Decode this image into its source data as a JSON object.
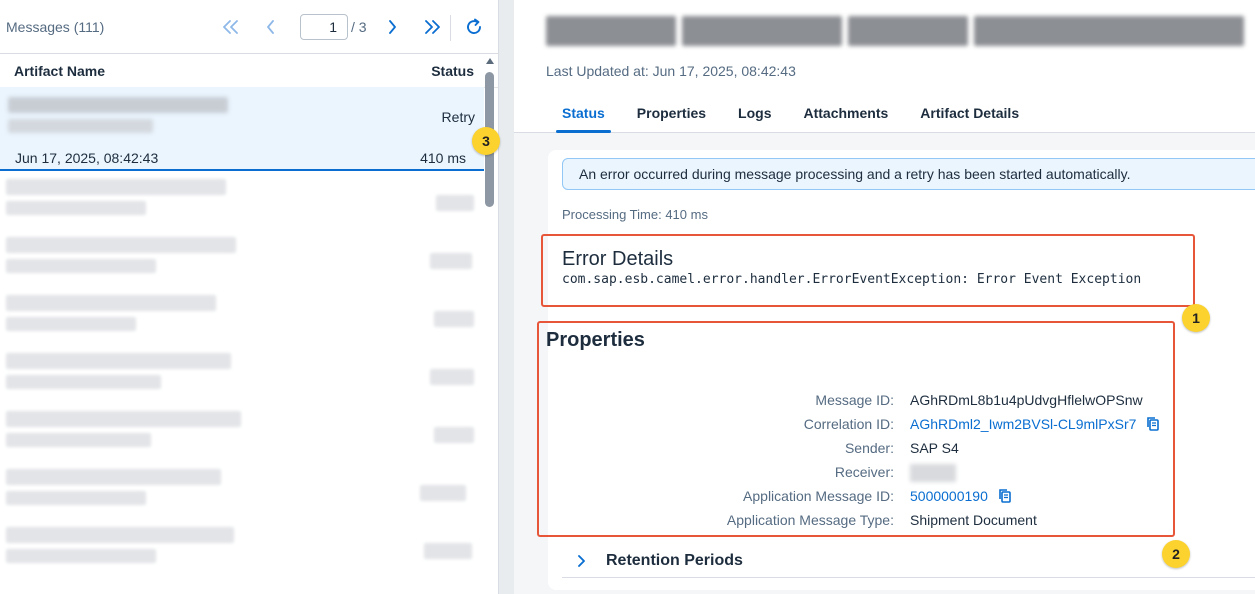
{
  "left_pane": {
    "messages_count": "Messages (111)",
    "page_current": "1",
    "page_total": "/ 3",
    "columns": {
      "artifact": "Artifact Name",
      "status": "Status"
    },
    "selected_row": {
      "status": "Retry",
      "date": "Jun 17, 2025, 08:42:43",
      "duration": "410 ms"
    }
  },
  "header": {
    "last_updated": "Last Updated at: Jun 17, 2025, 08:42:43",
    "tabs": [
      {
        "label": "Status",
        "active": true
      },
      {
        "label": "Properties",
        "active": false
      },
      {
        "label": "Logs",
        "active": false
      },
      {
        "label": "Attachments",
        "active": false
      },
      {
        "label": "Artifact Details",
        "active": false
      }
    ]
  },
  "status": {
    "message_strip": "An error occurred during message processing and a retry has been started automatically.",
    "processing_time": "Processing Time: 410 ms",
    "error_title": "Error Details",
    "error_text": "com.sap.esb.camel.error.handler.ErrorEventException: Error Event Exception"
  },
  "properties": {
    "title": "Properties",
    "items": [
      {
        "key": "Message ID:",
        "value": "AGhRDmL8b1u4pUdvgHflelwOPSnw"
      },
      {
        "key": "Correlation ID:",
        "value": "AGhRDml2_Iwm2BVSl-CL9mlPxSr7"
      },
      {
        "key": "Sender:",
        "value": "SAP S4"
      },
      {
        "key": "Receiver:",
        "value": ""
      },
      {
        "key": "Application Message ID:",
        "value": "5000000190"
      },
      {
        "key": "Application Message Type:",
        "value": "Shipment Document"
      }
    ]
  },
  "retention": {
    "label": "Retention Periods"
  },
  "annotations": {
    "badge1": "1",
    "badge2": "2",
    "badge3": "3"
  },
  "colors": {
    "accent": "#0a6ed1",
    "annotation": "#e8563a",
    "badge": "#fbd22e"
  }
}
